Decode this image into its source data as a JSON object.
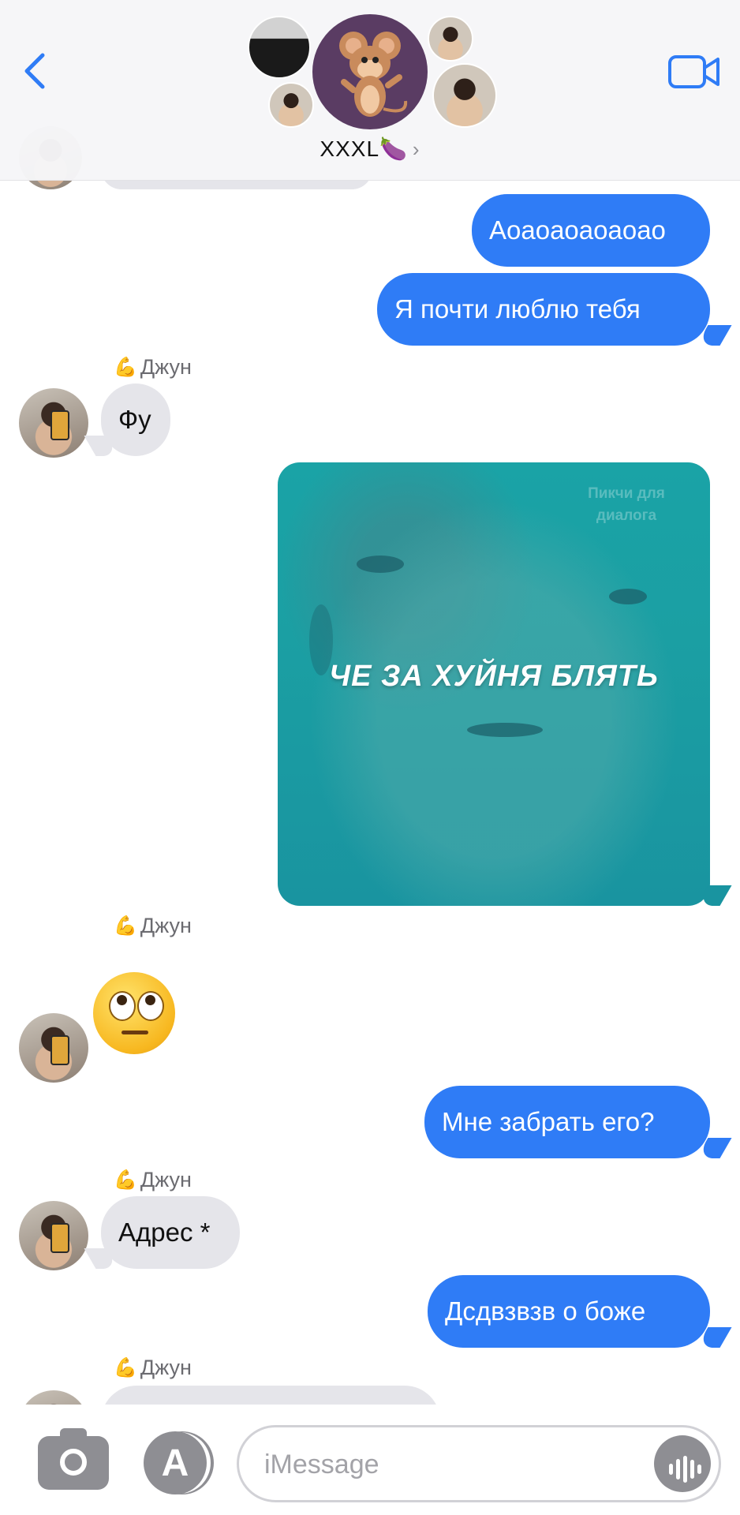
{
  "header": {
    "group_name": "XXXL🍆",
    "chevron": "›",
    "back_icon": "chevron-left-icon",
    "video_icon": "video-camera-icon",
    "accent_color": "#2f7cf6"
  },
  "messages": [
    {
      "type": "text",
      "direction": "sent",
      "text": "Аоаоаоаоаоао"
    },
    {
      "type": "text",
      "direction": "sent",
      "text": "Я почти люблю тебя"
    },
    {
      "type": "sender",
      "name": "Джун",
      "emoji": "💪"
    },
    {
      "type": "text",
      "direction": "received",
      "text": "Фу"
    },
    {
      "type": "image",
      "direction": "sent",
      "caption": "ЧЕ ЗА ХУЙНЯ БЛЯТЬ",
      "watermark": "Пикчи для диалога"
    },
    {
      "type": "sender",
      "name": "Джун",
      "emoji": "💪"
    },
    {
      "type": "emoji",
      "direction": "received",
      "emoji": "🙄"
    },
    {
      "type": "text",
      "direction": "sent",
      "text": "Мне забрать его?"
    },
    {
      "type": "sender",
      "name": "Джун",
      "emoji": "💪"
    },
    {
      "type": "text",
      "direction": "received",
      "text": "Адрес *"
    },
    {
      "type": "text",
      "direction": "sent",
      "text": "Дсдвзвзв о боже"
    },
    {
      "type": "sender",
      "name": "Джун",
      "emoji": "💪"
    }
  ],
  "composer": {
    "placeholder": "iMessage",
    "value": "",
    "camera_icon": "camera-icon",
    "apps_icon": "app-store-icon",
    "audio_icon": "audio-waveform-icon",
    "apps_glyph": "A"
  },
  "colors": {
    "sent_bubble": "#2f7cf6",
    "received_bubble": "#e5e5ea",
    "meme_background": "#1aa3a6"
  }
}
